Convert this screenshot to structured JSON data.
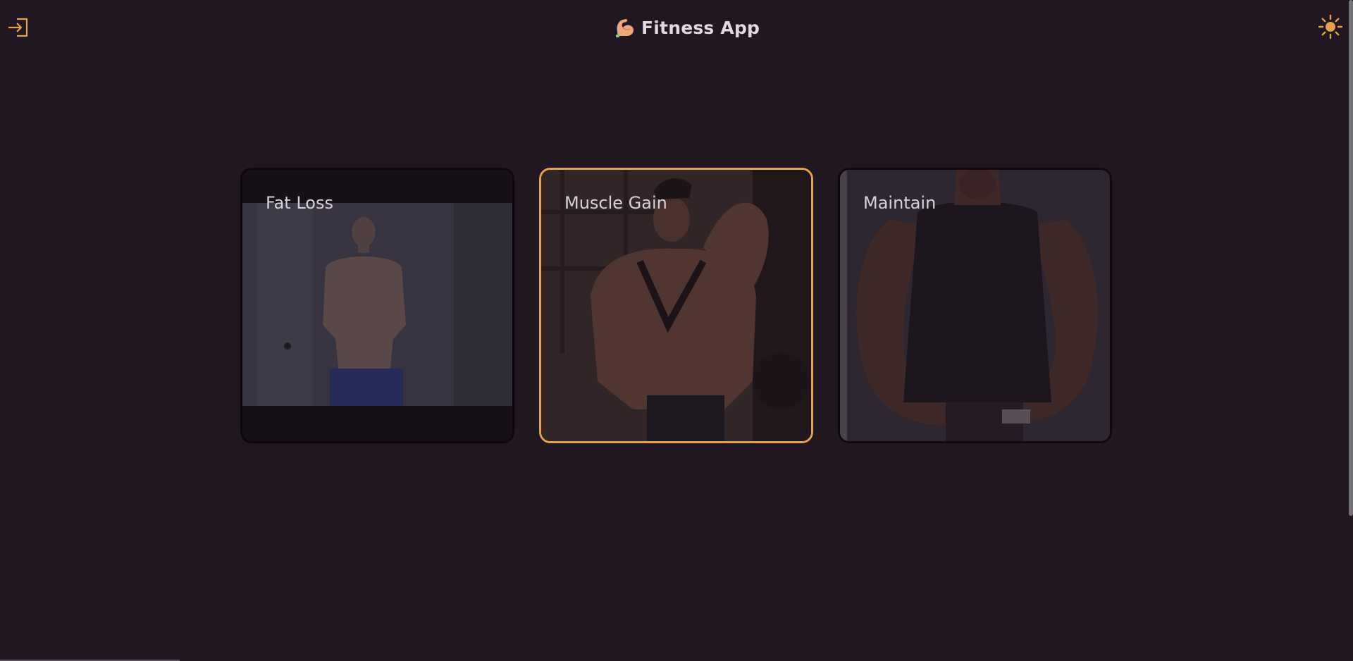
{
  "header": {
    "title": "Fitness App",
    "logo_icon": "flexed-biceps-icon",
    "login_icon": "sign-in-icon",
    "theme_icon": "sun-icon"
  },
  "goals": [
    {
      "label": "Fat Loss",
      "selected": false
    },
    {
      "label": "Muscle Gain",
      "selected": true
    },
    {
      "label": "Maintain",
      "selected": false
    }
  ],
  "colors": {
    "background": "#201720",
    "accent": "#e8a04c"
  }
}
